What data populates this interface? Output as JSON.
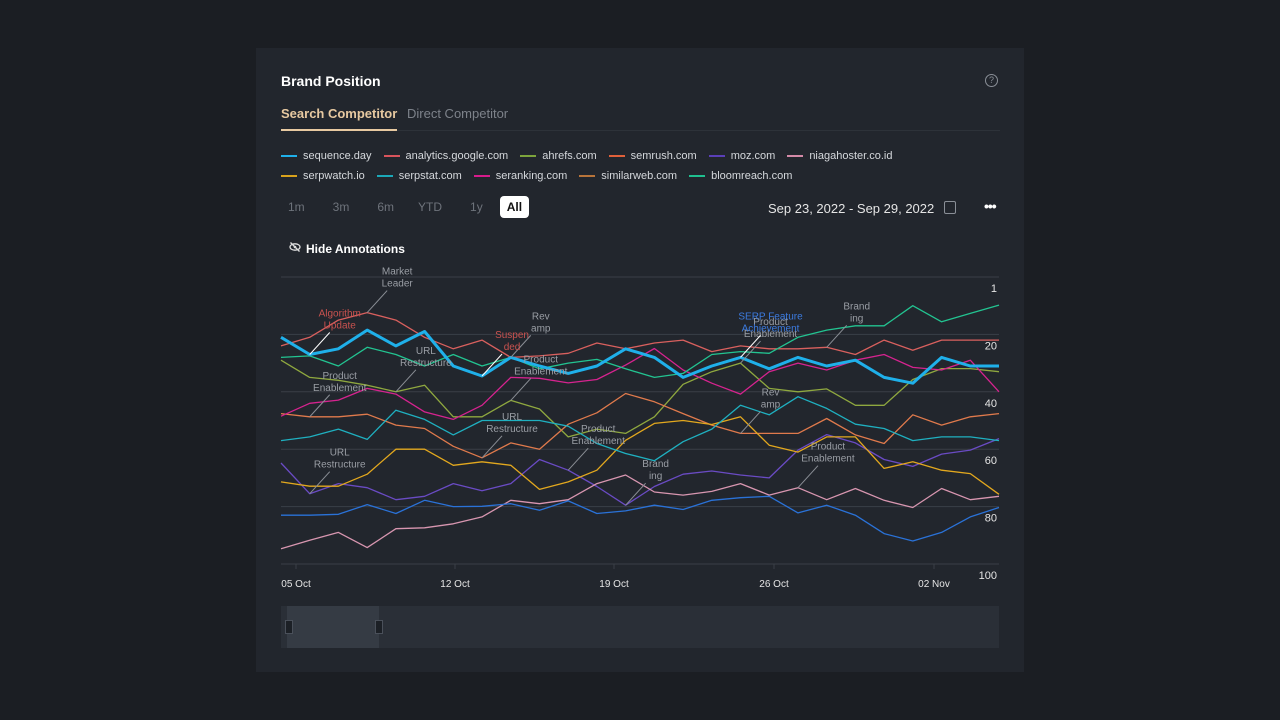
{
  "card": {
    "title": "Brand Position",
    "help_icon": "question-circle-icon"
  },
  "tabs": [
    {
      "label": "Search Competitor",
      "active": true
    },
    {
      "label": "Direct Competitor",
      "active": false
    }
  ],
  "ranges": [
    {
      "label": "1m"
    },
    {
      "label": "3m"
    },
    {
      "label": "6m"
    },
    {
      "label": "YTD"
    },
    {
      "label": "1y"
    },
    {
      "label": "All",
      "active": true
    }
  ],
  "date_range": "Sep 23, 2022 - Sep 29, 2022",
  "hide_annotations": "Hide Annotations",
  "chart_data": {
    "type": "line",
    "y_axis": {
      "reversed": true,
      "range": [
        1,
        100
      ],
      "ticks": [
        "1",
        "20",
        "40",
        "60",
        "80",
        "100"
      ],
      "position": "right"
    },
    "x_axis": {
      "ticks": [
        "05 Oct",
        "12 Oct",
        "19 Oct",
        "26 Oct",
        "02 Nov"
      ]
    },
    "grid": true,
    "legend": "top",
    "x": [
      "2022-10-04 08:00",
      "2022-10-05 14:00",
      "2022-10-06 20:00",
      "2022-10-08 02:00",
      "2022-10-09 08:00",
      "2022-10-10 14:00",
      "2022-10-11 20:00",
      "2022-10-13 02:00",
      "2022-10-14 08:00",
      "2022-10-15 14:00",
      "2022-10-16 20:00",
      "2022-10-18 02:00",
      "2022-10-19 08:00",
      "2022-10-20 14:00",
      "2022-10-21 20:00",
      "2022-10-23 02:00",
      "2022-10-24 08:00",
      "2022-10-25 14:00",
      "2022-10-26 20:00",
      "2022-10-28 02:00",
      "2022-10-29 08:00",
      "2022-10-30 14:00",
      "2022-10-31 20:00",
      "2022-11-02 02:00",
      "2022-11-03 08:00",
      "2022-11-04 14:00"
    ],
    "series": [
      {
        "name": "sequence.day",
        "color": "#1fb0ea",
        "line_color": "#1fb0ea",
        "width": 3,
        "values": [
          21,
          27,
          25,
          18.5,
          24,
          19,
          31,
          34.5,
          28,
          31,
          33.6,
          31,
          25,
          28,
          35,
          31,
          28,
          32,
          28,
          31,
          29,
          35,
          37,
          28,
          31,
          31
        ]
      },
      {
        "name": "analytics.google.com",
        "color": "#d9545c",
        "line_color": "#d9605e",
        "values": [
          24,
          21,
          15,
          12.4,
          15,
          21,
          25,
          22,
          28,
          27.5,
          26.6,
          23,
          25,
          23,
          22,
          26,
          24,
          25,
          25,
          24.5,
          27,
          22,
          25.5,
          22,
          22,
          22
        ]
      },
      {
        "name": "ahrefs.com",
        "color": "#7da43c",
        "line_color": "#8fa83f",
        "values": [
          29,
          35,
          36,
          37.7,
          40,
          37.7,
          48.7,
          48.7,
          43,
          46,
          55.7,
          53,
          54.5,
          48.7,
          37.4,
          33,
          30,
          38.8,
          40,
          39,
          44.7,
          44.7,
          35.7,
          31.9,
          31.9,
          33
        ]
      },
      {
        "name": "semrush.com",
        "color": "#e0603a",
        "line_color": "#e07a4c",
        "values": [
          47.6,
          48.7,
          48.7,
          47.8,
          51.6,
          52.8,
          59,
          63,
          57.8,
          60,
          51.3,
          47.3,
          40.6,
          43.5,
          47.6,
          51.6,
          54.5,
          54.5,
          54.5,
          49.3,
          55,
          58,
          48,
          51.6,
          48.7,
          47.6
        ]
      },
      {
        "name": "moz.com",
        "color": "#5a3fb8",
        "line_color": "#6a4bc4",
        "values": [
          64.8,
          75.5,
          72,
          73.4,
          77.6,
          76.4,
          72,
          74.5,
          72,
          63.6,
          67.3,
          73,
          79.5,
          73,
          68.7,
          67.6,
          69,
          70,
          60.3,
          54.9,
          57.8,
          63.6,
          66,
          61.7,
          60.3,
          56.3
        ]
      },
      {
        "name": "niagahoster.co.id",
        "color": "#d48aa8",
        "line_color": "#d896b0",
        "values": [
          94.7,
          91.7,
          89,
          94.3,
          87.7,
          87.4,
          86,
          83.6,
          77.8,
          79,
          77.6,
          72,
          69,
          74.9,
          76,
          74.7,
          72,
          76,
          73.4,
          77.6,
          73.7,
          77.8,
          80.3,
          73.7,
          77.6,
          76.4
        ]
      },
      {
        "name": "serpwatch.io",
        "color": "#d9a21c",
        "line_color": "#e3a81e",
        "values": [
          71.4,
          72.9,
          72.9,
          68.7,
          60,
          60,
          65.6,
          64.4,
          65.6,
          74,
          71.4,
          67.3,
          56.9,
          51,
          50,
          51.4,
          48.7,
          58.6,
          61,
          55.7,
          55.7,
          66.7,
          64.4,
          67.3,
          68.5,
          75.7
        ]
      },
      {
        "name": "serpstat.com",
        "color": "#1ba8b8",
        "line_color": "#1fb0c0",
        "values": [
          57,
          55.7,
          53,
          56.6,
          46.4,
          49.6,
          55,
          50,
          50,
          50,
          52,
          58,
          61.5,
          64,
          57.4,
          53,
          44.7,
          48,
          41.7,
          45.8,
          51.3,
          52.8,
          57,
          55.7,
          55.7,
          57
        ]
      },
      {
        "name": "seranking.com",
        "color": "#d81b8c",
        "line_color": "#d6238f",
        "values": [
          48.5,
          44,
          42.9,
          38.8,
          40.8,
          47,
          49.6,
          44.7,
          35,
          35.3,
          36.9,
          35.7,
          30.7,
          24.9,
          32.4,
          37,
          40.8,
          33,
          30,
          32.4,
          29,
          27,
          31.5,
          32.4,
          29,
          40
        ]
      },
      {
        "name": "similarweb.com",
        "color": "#b8743a",
        "line_color": "#2a72d8",
        "values": [
          83,
          83,
          82.7,
          79.3,
          82.4,
          77.8,
          80,
          79.9,
          79,
          81.3,
          78,
          82.4,
          81.5,
          79.5,
          81,
          77.8,
          76.9,
          76.4,
          82.2,
          79.5,
          83,
          89.4,
          92,
          89,
          83.6,
          80.3
        ]
      },
      {
        "name": "bloomreach.com",
        "color": "#1fbf8f",
        "line_color": "#22c491",
        "values": [
          28,
          27.5,
          31,
          24.5,
          27,
          31,
          27,
          31,
          28,
          32,
          30,
          28.7,
          32,
          35,
          33.6,
          27,
          26,
          26.6,
          21,
          18.5,
          17,
          17,
          10,
          15.6,
          12.7,
          9.8
        ]
      }
    ],
    "annotations": [
      {
        "lines": [
          "Market",
          "Leader"
        ],
        "series": "analytics.google.com",
        "index": 3,
        "color": "#9a9ea5"
      },
      {
        "lines": [
          "Algorithm",
          "Update"
        ],
        "series": "sequence.day",
        "index": 1,
        "color": "#c9524f"
      },
      {
        "lines": [
          "URL",
          "Restructure"
        ],
        "series": "ahrefs.com",
        "index": 4,
        "color": "#9a9ea5"
      },
      {
        "lines": [
          "Product",
          "Enablement"
        ],
        "series": "semrush.com",
        "index": 1,
        "color": "#9a9ea5"
      },
      {
        "lines": [
          "Rev",
          "amp"
        ],
        "series": "bloomreach.com",
        "index": 8,
        "color": "#9a9ea5"
      },
      {
        "lines": [
          "Suspen",
          "ded"
        ],
        "series": "sequence.day",
        "index": 7,
        "color": "#c9524f"
      },
      {
        "lines": [
          "Product",
          "Enablement"
        ],
        "series": "ahrefs.com",
        "index": 8,
        "color": "#9a9ea5"
      },
      {
        "lines": [
          "URL",
          "Restructure"
        ],
        "series": "semrush.com",
        "index": 7,
        "color": "#9a9ea5"
      },
      {
        "lines": [
          "URL",
          "Restructure"
        ],
        "series": "moz.com",
        "index": 1,
        "color": "#9a9ea5"
      },
      {
        "lines": [
          "Product",
          "Enablement"
        ],
        "series": "moz.com",
        "index": 10,
        "color": "#9a9ea5"
      },
      {
        "lines": [
          "Brand",
          "ing"
        ],
        "series": "moz.com",
        "index": 12,
        "color": "#9a9ea5"
      },
      {
        "lines": [
          "Product",
          "Enablement"
        ],
        "series": "ahrefs.com",
        "index": 16,
        "color": "#9a9ea5"
      },
      {
        "lines": [
          "SERP Feature",
          "Achievement"
        ],
        "series": "sequence.day",
        "index": 16,
        "color": "#3c7be0"
      },
      {
        "lines": [
          "Brand",
          "ing"
        ],
        "series": "analytics.google.com",
        "index": 19,
        "color": "#9a9ea5"
      },
      {
        "lines": [
          "Rev",
          "amp"
        ],
        "series": "semrush.com",
        "index": 16,
        "color": "#9a9ea5"
      },
      {
        "lines": [
          "Product",
          "Enablement"
        ],
        "series": "niagahoster.co.id",
        "index": 18,
        "color": "#9a9ea5"
      }
    ]
  }
}
